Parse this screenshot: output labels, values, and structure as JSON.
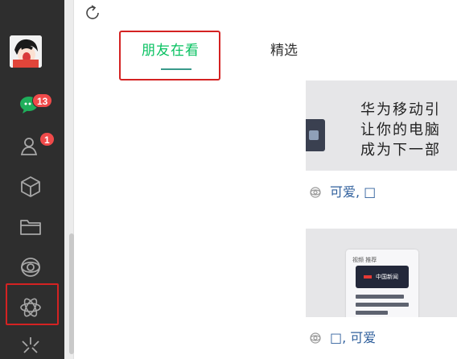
{
  "sidebar": {
    "chat_badge": "13",
    "contacts_badge": "1",
    "icons": [
      "chat-icon",
      "contacts-icon",
      "favorites-icon",
      "files-icon",
      "moments-icon",
      "top-stories-icon",
      "mini-programs-icon"
    ]
  },
  "header": {
    "refresh_icon": "refresh-icon"
  },
  "tabs": [
    {
      "label": "朋友在看",
      "active": true
    },
    {
      "label": "精选",
      "active": false
    }
  ],
  "feed": [
    {
      "preview_lines": [
        "华为移动引",
        "让你的电脑",
        "成为下一部"
      ],
      "meta_text": "可爱, □"
    },
    {
      "phone_header": "视频  推荐",
      "phone_screen_text": "中国新闻",
      "meta_text": "□, 可爱"
    }
  ],
  "colors": {
    "sidebar_bg": "#2e2e2e",
    "accent_green": "#07c160",
    "badge_red": "#f04a4a",
    "highlight_red": "#d42222",
    "link_blue": "#2f5f9c"
  }
}
